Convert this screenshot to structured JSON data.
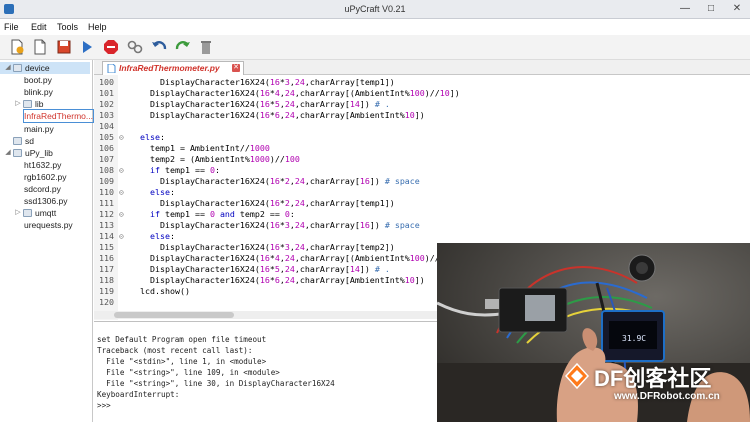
{
  "window": {
    "title": "uPyCraft V0.21",
    "min": "—",
    "max": "□",
    "close": "✕"
  },
  "menu": [
    "File",
    "Edit",
    "Tools",
    "Help"
  ],
  "toolbar": [
    "new-file-icon",
    "open-file-icon",
    "save-icon",
    "run-icon",
    "stop-icon",
    "connect-icon",
    "undo-icon",
    "redo-icon",
    "trash-icon"
  ],
  "sidebar": {
    "items": [
      {
        "label": "device",
        "indent": 1,
        "expander": "◢",
        "icon": "folder-icon",
        "selected": true
      },
      {
        "label": "boot.py",
        "indent": 2,
        "expander": "",
        "icon": ""
      },
      {
        "label": "blink.py",
        "indent": 2,
        "expander": "",
        "icon": ""
      },
      {
        "label": "lib",
        "indent": 2,
        "expander": "▷",
        "icon": "folder-icon"
      },
      {
        "label": "InfraRedThermo...",
        "indent": 2,
        "expander": "",
        "icon": "",
        "highlight": true
      },
      {
        "label": "main.py",
        "indent": 2,
        "expander": "",
        "icon": ""
      },
      {
        "label": "sd",
        "indent": 1,
        "expander": "",
        "icon": "folder-icon"
      },
      {
        "label": "uPy_lib",
        "indent": 1,
        "expander": "◢",
        "icon": "folder-icon"
      },
      {
        "label": "ht1632.py",
        "indent": 2,
        "expander": "",
        "icon": ""
      },
      {
        "label": "rgb1602.py",
        "indent": 2,
        "expander": "",
        "icon": ""
      },
      {
        "label": "sdcord.py",
        "indent": 2,
        "expander": "",
        "icon": ""
      },
      {
        "label": "ssd1306.py",
        "indent": 2,
        "expander": "",
        "icon": ""
      },
      {
        "label": "umqtt",
        "indent": 2,
        "expander": "▷",
        "icon": "folder-icon"
      },
      {
        "label": "urequests.py",
        "indent": 2,
        "expander": "",
        "icon": ""
      }
    ]
  },
  "tab": {
    "label": "InfraRedThermometer.py",
    "close": "✕"
  },
  "code": [
    {
      "n": "100",
      "fold": "",
      "t": "      DisplayCharacter16X24(16*3,24,charArray[temp1])"
    },
    {
      "n": "101",
      "fold": "",
      "t": "    DisplayCharacter16X24(16*4,24,charArray[(AmbientInt%100)//10])"
    },
    {
      "n": "102",
      "fold": "",
      "t": "    DisplayCharacter16X24(16*5,24,charArray[14]) # ."
    },
    {
      "n": "103",
      "fold": "",
      "t": "    DisplayCharacter16X24(16*6,24,charArray[AmbientInt%10])"
    },
    {
      "n": "104",
      "fold": "",
      "t": ""
    },
    {
      "n": "105",
      "fold": "⊝",
      "t": "  else:"
    },
    {
      "n": "106",
      "fold": "",
      "t": "    temp1 = AmbientInt//1000"
    },
    {
      "n": "107",
      "fold": "",
      "t": "    temp2 = (AmbientInt%1000)//100"
    },
    {
      "n": "108",
      "fold": "⊝",
      "t": "    if temp1 == 0:"
    },
    {
      "n": "109",
      "fold": "",
      "t": "      DisplayCharacter16X24(16*2,24,charArray[16]) # space"
    },
    {
      "n": "110",
      "fold": "⊝",
      "t": "    else:"
    },
    {
      "n": "111",
      "fold": "",
      "t": "      DisplayCharacter16X24(16*2,24,charArray[temp1])"
    },
    {
      "n": "112",
      "fold": "⊝",
      "t": "    if temp1 == 0 and temp2 == 0:"
    },
    {
      "n": "113",
      "fold": "",
      "t": "      DisplayCharacter16X24(16*3,24,charArray[16]) # space"
    },
    {
      "n": "114",
      "fold": "⊝",
      "t": "    else:"
    },
    {
      "n": "115",
      "fold": "",
      "t": "      DisplayCharacter16X24(16*3,24,charArray[temp2])"
    },
    {
      "n": "116",
      "fold": "",
      "t": "    DisplayCharacter16X24(16*4,24,charArray[(AmbientInt%100)//"
    },
    {
      "n": "117",
      "fold": "",
      "t": "    DisplayCharacter16X24(16*5,24,charArray[14]) # ."
    },
    {
      "n": "118",
      "fold": "",
      "t": "    DisplayCharacter16X24(16*6,24,charArray[AmbientInt%10])"
    },
    {
      "n": "119",
      "fold": "",
      "t": "  lcd.show()"
    },
    {
      "n": "120",
      "fold": "",
      "t": ""
    }
  ],
  "console": [
    "set Default Program open file timeout",
    "Traceback (most recent call last):",
    "  File \"<stdin>\", line 1, in <module>",
    "  File \"<string>\", line 109, in <module>",
    "  File \"<string>\", line 30, in DisplayCharacter16X24",
    "KeyboardInterrupt:",
    ">>>"
  ],
  "overlay": {
    "oled_text": "31.9C",
    "watermark_brand": "DF创客社区",
    "watermark_url": "www.DFRobot.com.cn"
  },
  "colors": {
    "keyword": "#0000c0",
    "number": "#b000b0",
    "comment": "#3a6fb0",
    "tab_label": "#d0342c",
    "selection": "#cde3f7"
  }
}
